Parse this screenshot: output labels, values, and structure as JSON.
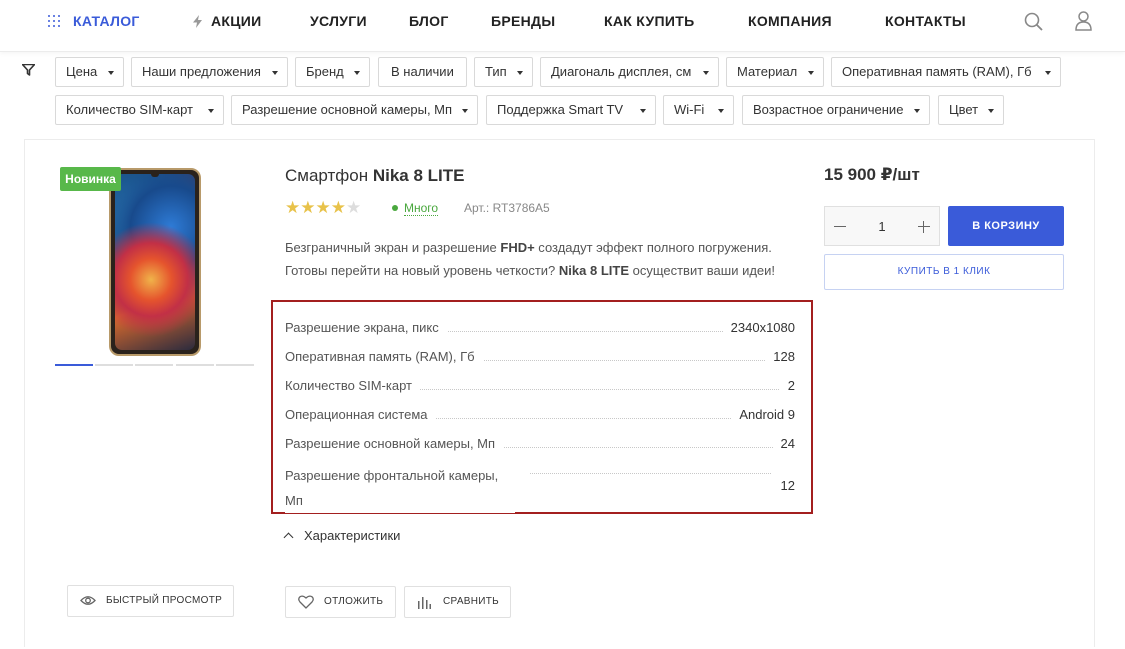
{
  "nav": {
    "items": [
      {
        "label": "КАТАЛОГ",
        "icon": "grid-icon",
        "active": true
      },
      {
        "label": "АКЦИИ",
        "icon": "bolt-icon"
      },
      {
        "label": "УСЛУГИ"
      },
      {
        "label": "БЛОГ"
      },
      {
        "label": "БРЕНДЫ"
      },
      {
        "label": "КАК КУПИТЬ"
      },
      {
        "label": "КОМПАНИЯ"
      },
      {
        "label": "КОНТАКТЫ"
      }
    ],
    "icons": [
      "search-icon",
      "user-icon"
    ],
    "accent_color": "#3a5bd9"
  },
  "filters": {
    "icon": "filter-icon",
    "chips": [
      "Цена",
      "Наши предложения",
      "Бренд",
      "В наличии",
      "Тип",
      "Диагональ дисплея, см",
      "Материал",
      "Оперативная память (RAM), Гб",
      "Количество SIM-карт",
      "Разрешение основной камеры, Мп",
      "Поддержка Smart TV",
      "Wi-Fi",
      "Возрастное ограничение",
      "Цвет"
    ]
  },
  "product": {
    "badge": "Новинка",
    "badge_color": "#58b84a",
    "title": "Смартфон Nika 8 LITE",
    "rating": {
      "value": 4,
      "max": 5
    },
    "stock": "Много",
    "sku": "Арт.: RT3786A5",
    "description": [
      "Безграничный экран и разрешение FHD+ создадут эффект полного погружения.",
      "Готовы перейти на новый уровень четкости? Nika 8 LITE осуществит ваши идеи!"
    ],
    "specs": [
      {
        "key": "Разрешение экрана, пикс",
        "value": "2340x1080"
      },
      {
        "key": "Оперативная память (RAM), Гб",
        "value": "128"
      },
      {
        "key": "Количество SIM-карт",
        "value": "2"
      },
      {
        "key": "Операционная система",
        "value": "Android 9"
      },
      {
        "key": "Разрешение основной камеры, Мп",
        "value": "24"
      },
      {
        "key": "Разрешение фронтальной камеры, Мп",
        "value": "12"
      }
    ],
    "characteristics_label": "Характеристики",
    "price": "15 900 ₽/шт",
    "quantity": "1",
    "add_to_cart": "В КОРЗИНУ",
    "one_click": "КУПИТЬ В 1 КЛИК",
    "quick_view": "БЫСТРЫЙ ПРОСМОТР",
    "postpone": "ОТЛОЖИТЬ",
    "compare": "СРАВНИТЬ",
    "gallery_active_index": 0,
    "gallery_count": 5
  }
}
